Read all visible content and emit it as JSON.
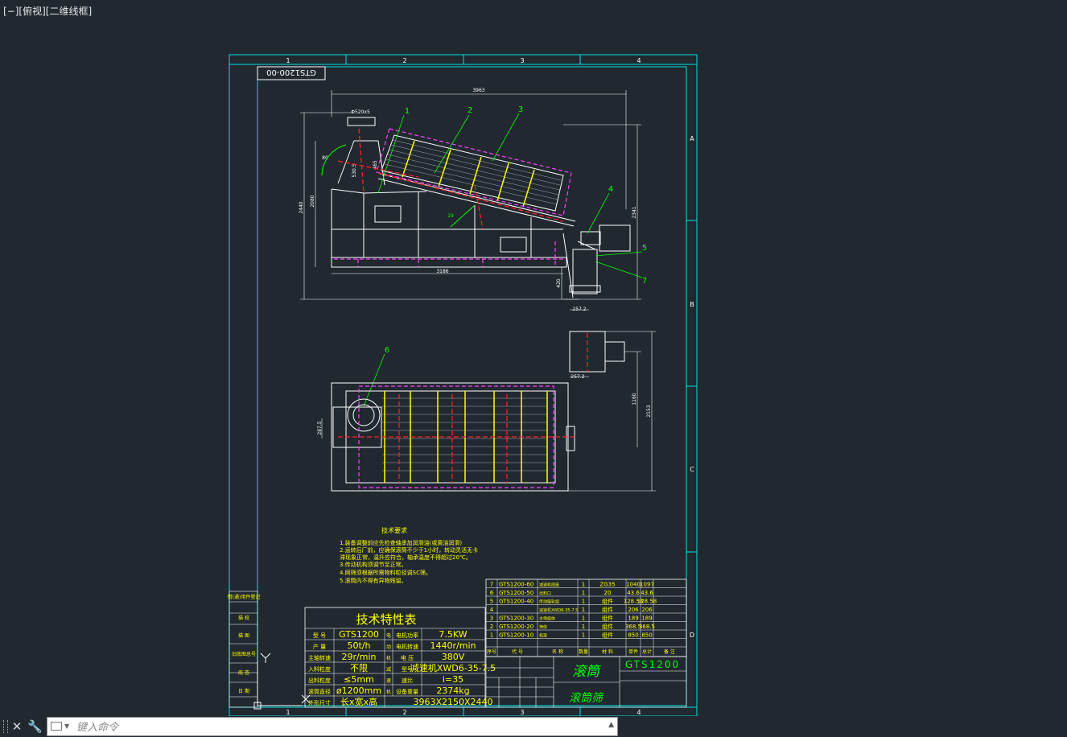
{
  "viewport": {
    "label": "[−][俯视][二维线框]"
  },
  "titleblock": {
    "drawing_no": "GTS1200-00",
    "model": "GTS1200",
    "name_glyphs_a": "滚筒",
    "name_glyphs_b": "滚筒筛"
  },
  "frame": {
    "cols": [
      "1",
      "2",
      "3",
      "4"
    ],
    "rows": [
      "A",
      "B",
      "C",
      "D"
    ]
  },
  "dims": {
    "overall_len": "3963",
    "base_len": "3186",
    "height_a": "2440",
    "height_b": "2080",
    "right_h": "2341",
    "foot_h": "420",
    "foot_w": "257.2",
    "foot_w2": "257.2",
    "inlet": "Φ520x5",
    "angle": "80",
    "plan_h1": "1160",
    "plan_h2": "2153",
    "plan_side": "287.5",
    "small_a": "530.5",
    "small_b": "465",
    "mid_mark": "19"
  },
  "callouts": [
    "1",
    "2",
    "3",
    "4",
    "5",
    "6",
    "7"
  ],
  "tech_req": {
    "title": "技术要求",
    "lines": [
      "1.装备调整前应先检查轴承加润滑油(或黄油润滑)",
      "2.运转后厂前，应确保滚筒不少于1小时，转动灵活无卡",
      "   滞现象正常，温升应符合，轴承温度不得超过20℃。",
      "3.传动机构须调节至正常。",
      "4.网筛须根据所需物料粒径调SC筛。",
      "5.滚筒内不得有异物残留。"
    ]
  },
  "spec": {
    "title": "技术特性表",
    "rows": [
      [
        "型 号",
        "GTS1200",
        "电",
        "电机功率",
        "7.5KW"
      ],
      [
        "产 量",
        "50t/h",
        "动",
        "电机转速",
        "1440r/min"
      ],
      [
        "主轴转速",
        "29r/min",
        "机",
        "电 压",
        "380V"
      ],
      [
        "入料粒度",
        "不限",
        "减",
        "型号",
        "减速机XWD6-35-7.5"
      ],
      [
        "出料粒度",
        "≤5mm",
        "速",
        "速比",
        "i=35"
      ],
      [
        "滚筒直径",
        "ø1200mm",
        "机",
        "设备重量",
        "2374kg"
      ],
      [
        "外形尺寸",
        "长x宽x高",
        "",
        "",
        "3963X2150X2440"
      ]
    ]
  },
  "bom": {
    "rows": [
      [
        "7",
        "GTS1200-60",
        "减速机底座",
        "1",
        "ZG35",
        "1040",
        "1097"
      ],
      [
        "6",
        "GTS1200-50",
        "出料口",
        "1",
        "20",
        "43.6",
        "43.6"
      ],
      [
        "5",
        "GTS1200-40",
        "传动链轮组",
        "1",
        "组件",
        "128.58",
        "128.58"
      ],
      [
        "4",
        "",
        "减速机XWD6-35-7.5",
        "1",
        "组件",
        "206",
        "206"
      ],
      [
        "3",
        "GTS1200-30",
        "主筛组体",
        "1",
        "组件",
        "189",
        "189"
      ],
      [
        "2",
        "GTS1200-20",
        "筛体",
        "1",
        "组件",
        "368.5",
        "368.5"
      ],
      [
        "1",
        "GTS1200-10",
        "机架",
        "1",
        "组件",
        "850",
        "850"
      ]
    ],
    "header": [
      "序号",
      "代 号",
      "名 称",
      "数量",
      "材 料",
      "单件",
      "总计",
      "备 注"
    ]
  },
  "left_strip": [
    "借(通)用件登记",
    "",
    "描 图",
    "描 校",
    "旧底图总号",
    "",
    "底 签",
    "日 期"
  ],
  "command": {
    "placeholder": "键入命令"
  },
  "colors": {
    "background": "#212830",
    "frame": "#00e5e5",
    "drawing": "#ffffff",
    "yellow": "#ffff00",
    "green": "#00ff00",
    "magenta": "#ff40ff",
    "red": "#ff2020"
  }
}
